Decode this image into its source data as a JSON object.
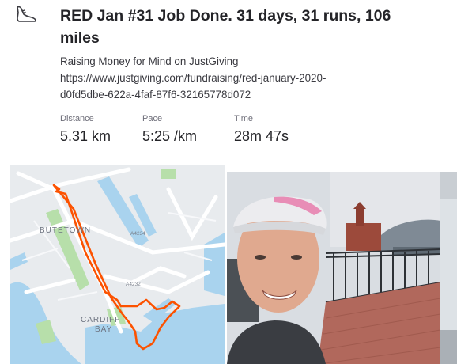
{
  "activity": {
    "title": "RED Jan #31 Job Done. 31 days, 31 runs, 106 miles",
    "sport_icon": "running-shoe-icon",
    "description_lines": [
      "Raising Money for Mind on JustGiving",
      "https://www.justgiving.com/fundraising/red-january-2020-",
      "d0fd5dbe-622a-4faf-87f6-32165778d072"
    ]
  },
  "stats": [
    {
      "label": "Distance",
      "value": "5.31 km"
    },
    {
      "label": "Pace",
      "value": "5:25 /km"
    },
    {
      "label": "Time",
      "value": "28m 47s"
    }
  ],
  "map": {
    "labels": {
      "butetown": "BUTETOWN",
      "cardiff": "CARDIFF",
      "bay": "BAY",
      "road1": "A4234",
      "road2": "A4232"
    },
    "route_color": "#fc5200",
    "water_color": "#a9d3ee",
    "park_color": "#b7dfaa"
  },
  "photo": {
    "subject": "runner selfie wearing pink cap by Cardiff Bay"
  }
}
